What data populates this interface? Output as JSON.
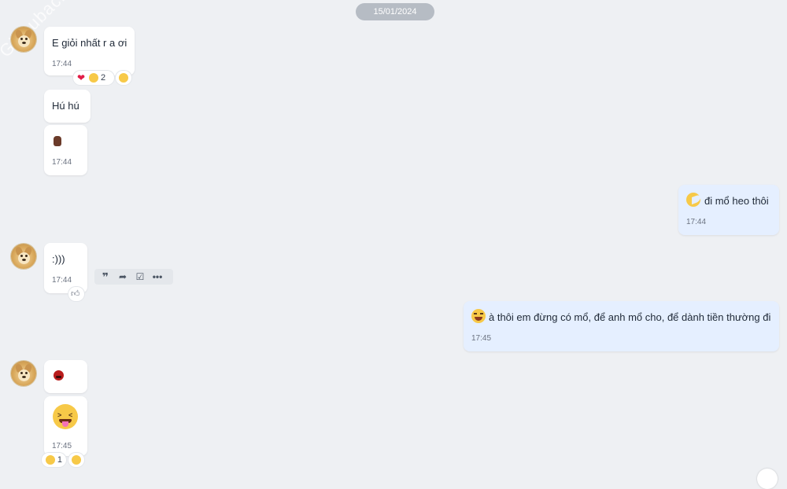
{
  "date_divider": "15/01/2024",
  "watermark": "Giasubachkhoa.net",
  "messages": [
    {
      "text": "E giỏi nhất r a ơi",
      "time": "17:44",
      "reactions": {
        "count": "2"
      }
    },
    {
      "text": "Hú hú"
    },
    {
      "time": "17:44",
      "content_icon": "fist-emoji"
    },
    {
      "text": "đi mổ heo thôi",
      "time": "17:44",
      "content_icon": "pacman-emoji"
    },
    {
      "text": ":)))",
      "time": "17:44"
    },
    {
      "text": "à thôi em đừng có mổ, để anh mổ cho, để dành tiền thường đi",
      "time": "17:45",
      "content_icon": "laughing-emoji"
    },
    {
      "content_icon": "angry-face-emoji"
    },
    {
      "time": "17:45",
      "content_icon": "tongue-squint-emoji",
      "reactions": {
        "count": "1"
      }
    }
  ],
  "toolbar": {
    "icons": [
      "quote-icon",
      "share-icon",
      "task-icon",
      "more-icon"
    ]
  },
  "colors": {
    "my_bubble": "#e5efff",
    "their_bubble": "#ffffff",
    "background": "#eef0f3"
  }
}
